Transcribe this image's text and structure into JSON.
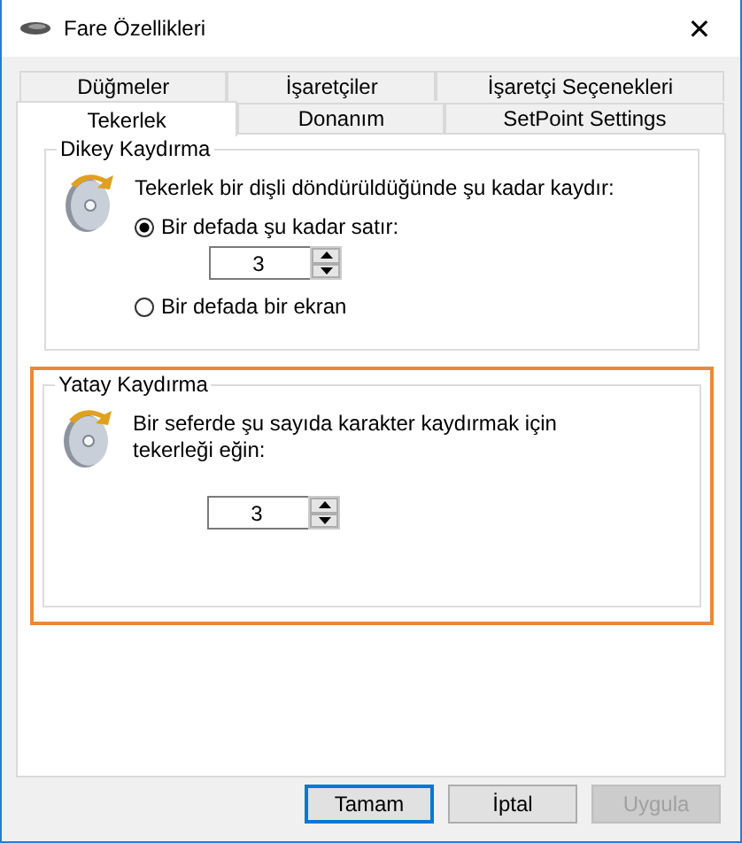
{
  "window": {
    "title": "Fare Özellikleri",
    "close_glyph": "✕"
  },
  "tab_rows": [
    [
      {
        "label": "Düğmeler",
        "selected": false
      },
      {
        "label": "İşaretçiler",
        "selected": false
      },
      {
        "label": "İşaretçi Seçenekleri",
        "selected": false
      }
    ],
    [
      {
        "label": "Tekerlek",
        "selected": true
      },
      {
        "label": "Donanım",
        "selected": false
      },
      {
        "label": "SetPoint Settings",
        "selected": false
      }
    ]
  ],
  "groups": [
    {
      "title": "Dikey Kaydırma",
      "highlighted": false,
      "description": "Tekerlek bir dişli döndürüldüğünde şu kadar kaydır:",
      "items": [
        {
          "kind": "radio",
          "label": "Bir defada şu kadar satır:",
          "selected": true
        },
        {
          "kind": "spinner",
          "value": "3"
        },
        {
          "kind": "radio",
          "label": "Bir defada bir ekran",
          "selected": false
        }
      ]
    },
    {
      "title": "Yatay Kaydırma",
      "highlighted": true,
      "description": "Bir seferde şu sayıda karakter kaydırmak için tekerleği eğin:",
      "items": [
        {
          "kind": "spinner",
          "value": "3"
        }
      ]
    }
  ],
  "buttons": [
    {
      "label": "Tamam",
      "default": true,
      "disabled": false
    },
    {
      "label": "İptal",
      "default": false,
      "disabled": false
    },
    {
      "label": "Uygula",
      "default": false,
      "disabled": true
    }
  ]
}
